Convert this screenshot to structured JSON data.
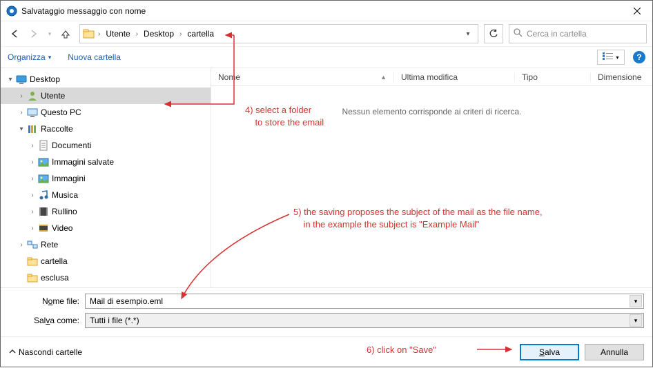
{
  "window": {
    "title": "Salvataggio messaggio con nome"
  },
  "breadcrumbs": {
    "p0": "Utente",
    "p1": "Desktop",
    "p2": "cartella"
  },
  "search": {
    "placeholder": "Cerca in cartella"
  },
  "toolbar": {
    "organize": "Organizza",
    "new_folder": "Nuova cartella"
  },
  "columns": {
    "name": "Nome",
    "modified": "Ultima modifica",
    "type": "Tipo",
    "size": "Dimensione"
  },
  "content": {
    "empty": "Nessun elemento corrisponde ai criteri di ricerca."
  },
  "tree": {
    "items": [
      {
        "label": "Desktop"
      },
      {
        "label": "Utente"
      },
      {
        "label": "Questo PC"
      },
      {
        "label": "Raccolte"
      },
      {
        "label": "Documenti"
      },
      {
        "label": "Immagini salvate"
      },
      {
        "label": "Immagini"
      },
      {
        "label": "Musica"
      },
      {
        "label": "Rullino"
      },
      {
        "label": "Video"
      },
      {
        "label": "Rete"
      },
      {
        "label": "cartella"
      },
      {
        "label": "esclusa"
      }
    ]
  },
  "fields": {
    "filename_label_pre": "N",
    "filename_label_u": "o",
    "filename_label_post": "me file:",
    "filename_value": "Mail di esempio.eml",
    "savetype_label_pre": "Sal",
    "savetype_label_u": "v",
    "savetype_label_post": "a come:",
    "savetype_value": "Tutti i file (*.*)"
  },
  "footer": {
    "hide": "Nascondi cartelle",
    "save_pre": "",
    "save_u": "S",
    "save_post": "alva",
    "cancel": "Annulla"
  },
  "annotations": {
    "a4": "4) select a folder\n    to store the email",
    "a5": "5) the saving proposes the subject of the mail as the file name,\n    in the example the subject is \"Example Mail\"",
    "a6": "6) click on \"Save\""
  }
}
